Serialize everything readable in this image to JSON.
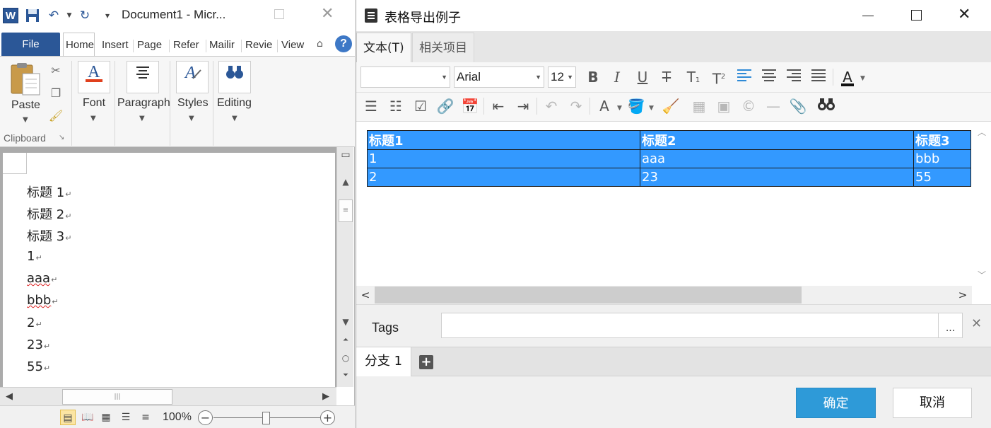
{
  "word": {
    "app_letter": "W",
    "doc_title": "Document1 - Micr...",
    "tabs": {
      "file": "File",
      "home": "Home",
      "insert": "Insert",
      "page": "Page",
      "refer": "Refer",
      "mailings": "Mailir",
      "review": "Revie",
      "view": "View"
    },
    "ribbon": {
      "paste": "Paste",
      "font": "Font",
      "paragraph": "Paragraph",
      "styles": "Styles",
      "editing": "Editing",
      "clipboard": "Clipboard"
    },
    "doc_lines": [
      "标题 1",
      "标题 2",
      "标题 3",
      "1",
      "aaa",
      "bbb",
      "2",
      "23",
      "55"
    ],
    "zoom": "100%"
  },
  "dialog": {
    "title": "表格导出例子",
    "tabs": {
      "text": "文本(T)",
      "related": "相关项目"
    },
    "toolbar": {
      "font_name": "Arial",
      "font_size": "12"
    },
    "table": {
      "headers": [
        "标题1",
        "标题2",
        "标题3"
      ],
      "rows": [
        [
          "1",
          "aaa",
          "bbb"
        ],
        [
          "2",
          "23",
          "55"
        ]
      ]
    },
    "tags_label": "Tags",
    "tags_value": "",
    "tags_more": "...",
    "branch_tab": "分支 1",
    "ok": "确定",
    "cancel": "取消"
  },
  "colors": {
    "word_blue": "#2b5797",
    "table_selection": "#3399ff",
    "ok_button": "#2e9ad8",
    "align_active": "#2f8ad6"
  }
}
